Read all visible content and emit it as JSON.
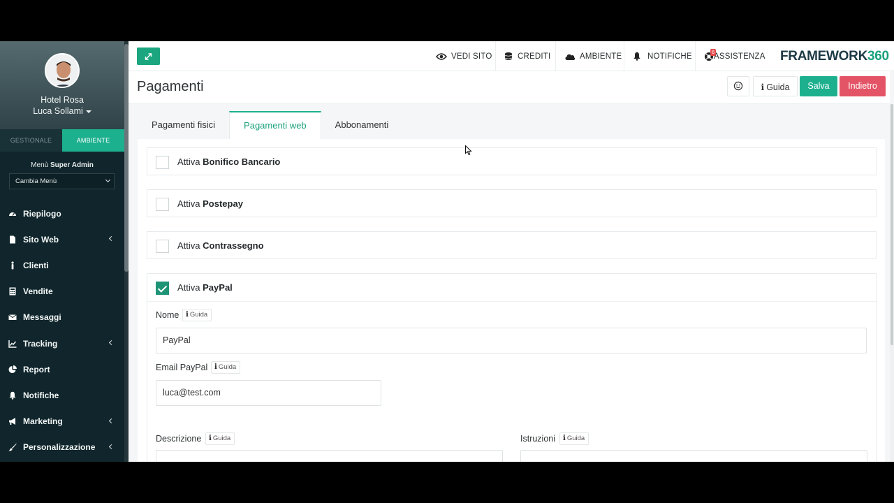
{
  "sidebar": {
    "hotel_name": "Hotel Rosa",
    "user_name": "Luca Sollami",
    "tabs": [
      {
        "label": "GESTIONALE",
        "active": false
      },
      {
        "label": "AMBIENTE",
        "active": true
      }
    ],
    "menu_title_prefix": "Menù",
    "menu_title_bold": "Super Admin",
    "menu_select_value": "Cambia Menù",
    "items": [
      {
        "label": "Riepilogo",
        "icon": "dashboard-icon",
        "has_arrow": false
      },
      {
        "label": "Sito Web",
        "icon": "file-icon",
        "has_arrow": true
      },
      {
        "label": "Clienti",
        "icon": "person-icon",
        "has_arrow": false
      },
      {
        "label": "Vendite",
        "icon": "calculator-icon",
        "has_arrow": false
      },
      {
        "label": "Messaggi",
        "icon": "envelope-icon",
        "has_arrow": false
      },
      {
        "label": "Tracking",
        "icon": "line-chart-icon",
        "has_arrow": true
      },
      {
        "label": "Report",
        "icon": "pie-chart-icon",
        "has_arrow": false
      },
      {
        "label": "Notifiche",
        "icon": "bell-icon",
        "has_arrow": false
      },
      {
        "label": "Marketing",
        "icon": "megaphone-icon",
        "has_arrow": true
      },
      {
        "label": "Personalizzazione",
        "icon": "brush-icon",
        "has_arrow": true
      }
    ]
  },
  "topbar": {
    "nav": [
      {
        "label": "VEDI SITO",
        "icon": "eye-icon"
      },
      {
        "label": "CREDITI",
        "icon": "coins-icon"
      },
      {
        "label": "AMBIENTE",
        "icon": "cloud-icon"
      },
      {
        "label": "NOTIFICHE",
        "icon": "bell-icon"
      },
      {
        "label": "ASSISTENZA",
        "icon": "support-icon",
        "badge": "6"
      }
    ],
    "logo_text": "FRAMEWORK",
    "logo_number": "360"
  },
  "header": {
    "title": "Pagamenti",
    "guida_label": "Guida",
    "salva_label": "Salva",
    "indietro_label": "Indietro"
  },
  "tabs": [
    {
      "label": "Pagamenti fisici",
      "active": false
    },
    {
      "label": "Pagamenti web",
      "active": true
    },
    {
      "label": "Abbonamenti",
      "active": false
    }
  ],
  "options": [
    {
      "prefix": "Attiva",
      "name": "Bonifico Bancario",
      "checked": false
    },
    {
      "prefix": "Attiva",
      "name": "Postepay",
      "checked": false
    },
    {
      "prefix": "Attiva",
      "name": "Contrassegno",
      "checked": false
    },
    {
      "prefix": "Attiva",
      "name": "PayPal",
      "checked": true
    }
  ],
  "paypal_form": {
    "guida_tag": "Guida",
    "nome_label": "Nome",
    "nome_value": "PayPal",
    "email_label": "Email PayPal",
    "email_value": "luca@test.com",
    "descrizione_label": "Descrizione",
    "istruzioni_label": "Istruzioni"
  },
  "colors": {
    "accent": "#1db08f",
    "danger": "#e35566",
    "sidebar_bg": "#10262c"
  }
}
